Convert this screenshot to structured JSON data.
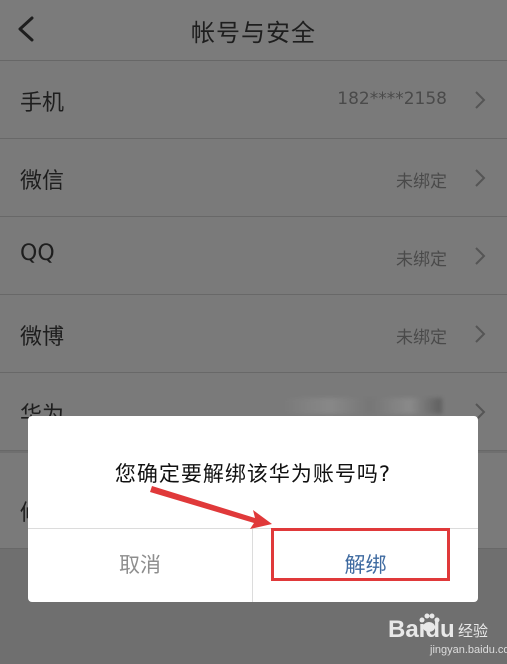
{
  "header": {
    "title": "帐号与安全",
    "back_icon": "chevron-left-icon"
  },
  "rows": [
    {
      "label": "手机",
      "value": "182****2158"
    },
    {
      "label": "微信",
      "value": "未绑定"
    },
    {
      "label": "QQ",
      "value": "未绑定"
    },
    {
      "label": "微博",
      "value": "未绑定"
    },
    {
      "label": "华为",
      "value": ""
    }
  ],
  "partial_row": {
    "label": "修"
  },
  "dialog": {
    "message": "您确定要解绑该华为账号吗?",
    "cancel_label": "取消",
    "confirm_label": "解绑"
  },
  "annotation": {
    "color": "#e0393a"
  },
  "watermark": {
    "logo": "Bai",
    "logo_suffix": "du",
    "text": "经验",
    "url": "jingyan.baidu.com"
  }
}
